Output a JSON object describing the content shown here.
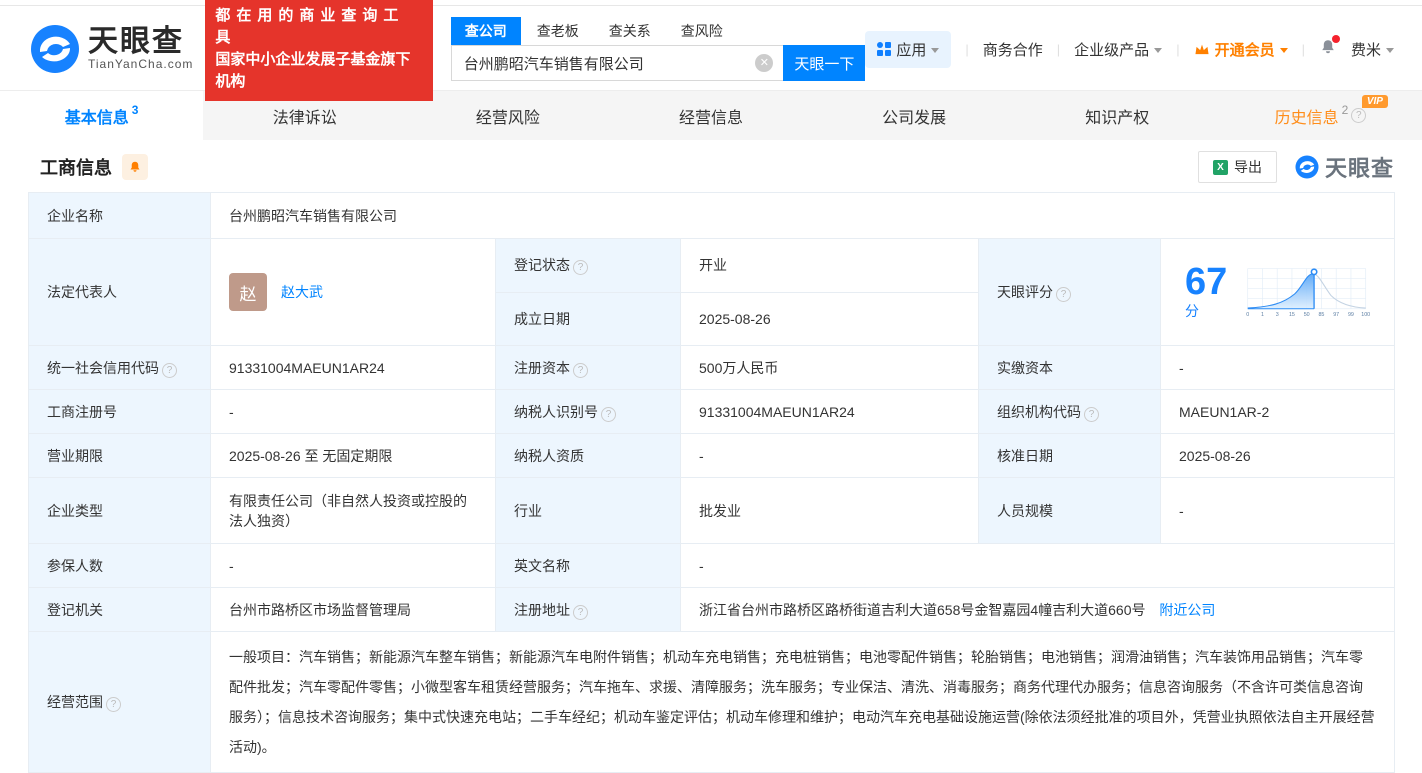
{
  "colors": {
    "primary": "#0084ff",
    "promo_red": "#e5342b",
    "vip_orange": "#ff8000",
    "status_green": "#3eb045",
    "history_orange": "#ff8d1a"
  },
  "header": {
    "logo": {
      "brand": "天眼查",
      "domain": "TianYanCha.com"
    },
    "promo": {
      "line1": "都在用的商业查询工具",
      "line2": "国家中小企业发展子基金旗下机构"
    },
    "search": {
      "tabs": [
        {
          "label": "查公司"
        },
        {
          "label": "查老板"
        },
        {
          "label": "查关系"
        },
        {
          "label": "查风险"
        }
      ],
      "value": "台州鹏昭汽车销售有限公司",
      "button": "天眼一下"
    },
    "nav": {
      "apps": "应用",
      "cooperation": "商务合作",
      "enterprise": "企业级产品",
      "vip": "开通会员",
      "user": "费米"
    }
  },
  "tabs": [
    {
      "label": "基本信息",
      "count": "3"
    },
    {
      "label": "法律诉讼"
    },
    {
      "label": "经营风险"
    },
    {
      "label": "经营信息"
    },
    {
      "label": "公司发展"
    },
    {
      "label": "知识产权"
    },
    {
      "label": "历史信息",
      "count": "2",
      "vip_badge": "VIP"
    }
  ],
  "section": {
    "title": "工商信息",
    "export_label": "导出",
    "watermark": "天眼查"
  },
  "fields": {
    "company_name": {
      "label": "企业名称",
      "value": "台州鹏昭汽车销售有限公司"
    },
    "legal_rep": {
      "label": "法定代表人",
      "avatar": "赵",
      "name": "赵大武"
    },
    "reg_status": {
      "label": "登记状态",
      "value": "开业"
    },
    "est_date": {
      "label": "成立日期",
      "value": "2025-08-26"
    },
    "score": {
      "label": "天眼评分",
      "value": "67",
      "unit": "分",
      "axis": [
        "0",
        "1",
        "3",
        "15",
        "50",
        "85",
        "97",
        "99",
        "100"
      ]
    },
    "credit_code": {
      "label": "统一社会信用代码",
      "value": "91331004MAEUN1AR24"
    },
    "reg_capital": {
      "label": "注册资本",
      "value": "500万人民币"
    },
    "paid_capital": {
      "label": "实缴资本",
      "value": "-"
    },
    "reg_number": {
      "label": "工商注册号",
      "value": "-"
    },
    "taxpayer_id": {
      "label": "纳税人识别号",
      "value": "91331004MAEUN1AR24"
    },
    "org_code": {
      "label": "组织机构代码",
      "value": "MAEUN1AR-2"
    },
    "business_term": {
      "label": "营业期限",
      "value": "2025-08-26 至 无固定期限"
    },
    "taxpayer_quality": {
      "label": "纳税人资质",
      "value": "-"
    },
    "approval_date": {
      "label": "核准日期",
      "value": "2025-08-26"
    },
    "company_type": {
      "label": "企业类型",
      "value": "有限责任公司（非自然人投资或控股的法人独资）"
    },
    "industry": {
      "label": "行业",
      "value": "批发业"
    },
    "staff_size": {
      "label": "人员规模",
      "value": "-"
    },
    "insured_count": {
      "label": "参保人数",
      "value": "-"
    },
    "english_name": {
      "label": "英文名称",
      "value": "-"
    },
    "reg_authority": {
      "label": "登记机关",
      "value": "台州市路桥区市场监督管理局"
    },
    "reg_address": {
      "label": "注册地址",
      "value": "浙江省台州市路桥区路桥街道吉利大道658号金智嘉园4幢吉利大道660号",
      "nearby_link": "附近公司"
    },
    "business_scope": {
      "label": "经营范围",
      "value": "一般项目：汽车销售；新能源汽车整车销售；新能源汽车电附件销售；机动车充电销售；充电桩销售；电池零配件销售；轮胎销售；电池销售；润滑油销售；汽车装饰用品销售；汽车零配件批发；汽车零配件零售；小微型客车租赁经营服务；汽车拖车、求援、清障服务；洗车服务；专业保洁、清洗、消毒服务；商务代理代办服务；信息咨询服务（不含许可类信息咨询服务）；信息技术咨询服务；集中式快速充电站；二手车经纪；机动车鉴定评估；机动车修理和维护；电动汽车充电基础设施运营(除依法须经批准的项目外，凭营业执照依法自主开展经营活动)。"
    }
  }
}
